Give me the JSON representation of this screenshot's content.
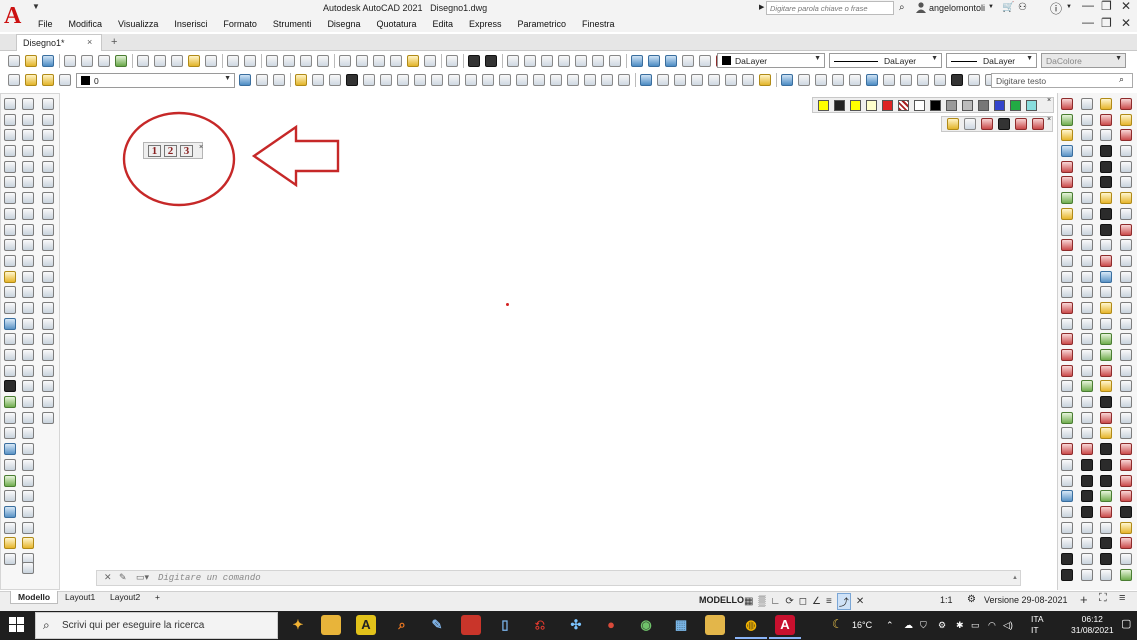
{
  "app": {
    "title": "Autodesk AutoCAD 2021",
    "document": "Disegno1.dwg",
    "logo_letter": "A"
  },
  "menus": [
    "File",
    "Modifica",
    "Visualizza",
    "Inserisci",
    "Formato",
    "Strumenti",
    "Disegna",
    "Quotatura",
    "Edita",
    "Express",
    "Parametrico",
    "Finestra"
  ],
  "help_search": {
    "placeholder": "Digitare parola chiave o frase"
  },
  "user": {
    "name": "angelomontoli"
  },
  "doc_tab": {
    "label": "Disegno1*",
    "close": "×",
    "add": "+"
  },
  "properties": {
    "layer_color_value": "DaLayer",
    "linetype_value": "DaLayer",
    "lineweight_value": "DaLayer",
    "plotstyle_value": "DaColore",
    "current_layer": "0"
  },
  "text_search": {
    "placeholder": "Digitare testo"
  },
  "float_toolbar": {
    "buttons": [
      "1",
      "2",
      "3"
    ],
    "close": "×"
  },
  "command_line": {
    "placeholder": "Digitare un comando"
  },
  "layout_tabs": [
    "Modello",
    "Layout1",
    "Layout2"
  ],
  "layout_add": "+",
  "status_bar": {
    "mode": "MODELLO",
    "scale": "1:1",
    "version": "Versione 29-08-2021"
  },
  "taskbar": {
    "search_placeholder": "Scrivi qui per eseguire la ricerca",
    "temperature": "16°C",
    "language_1": "ITA",
    "language_2": "IT",
    "time": "06:12",
    "date": "31/08/2021"
  },
  "colors": {
    "accent_red": "#cc1111",
    "annotation_red": "#c62828",
    "taskbar_bg": "#1f1f1f",
    "palette": [
      "#ffff00",
      "#000000",
      "#ffff00",
      "#ffffcc",
      "#dd2222",
      "#aa2222",
      "#ffffff",
      "#000000",
      "#999999",
      "#bbbbbb",
      "#777777",
      "#3344cc",
      "#22aa44",
      "#88dddd"
    ]
  },
  "icons": {
    "search": "search-icon",
    "user": "user-icon",
    "cart": "cart-icon",
    "help": "help-icon",
    "start": "windows-start-icon"
  }
}
